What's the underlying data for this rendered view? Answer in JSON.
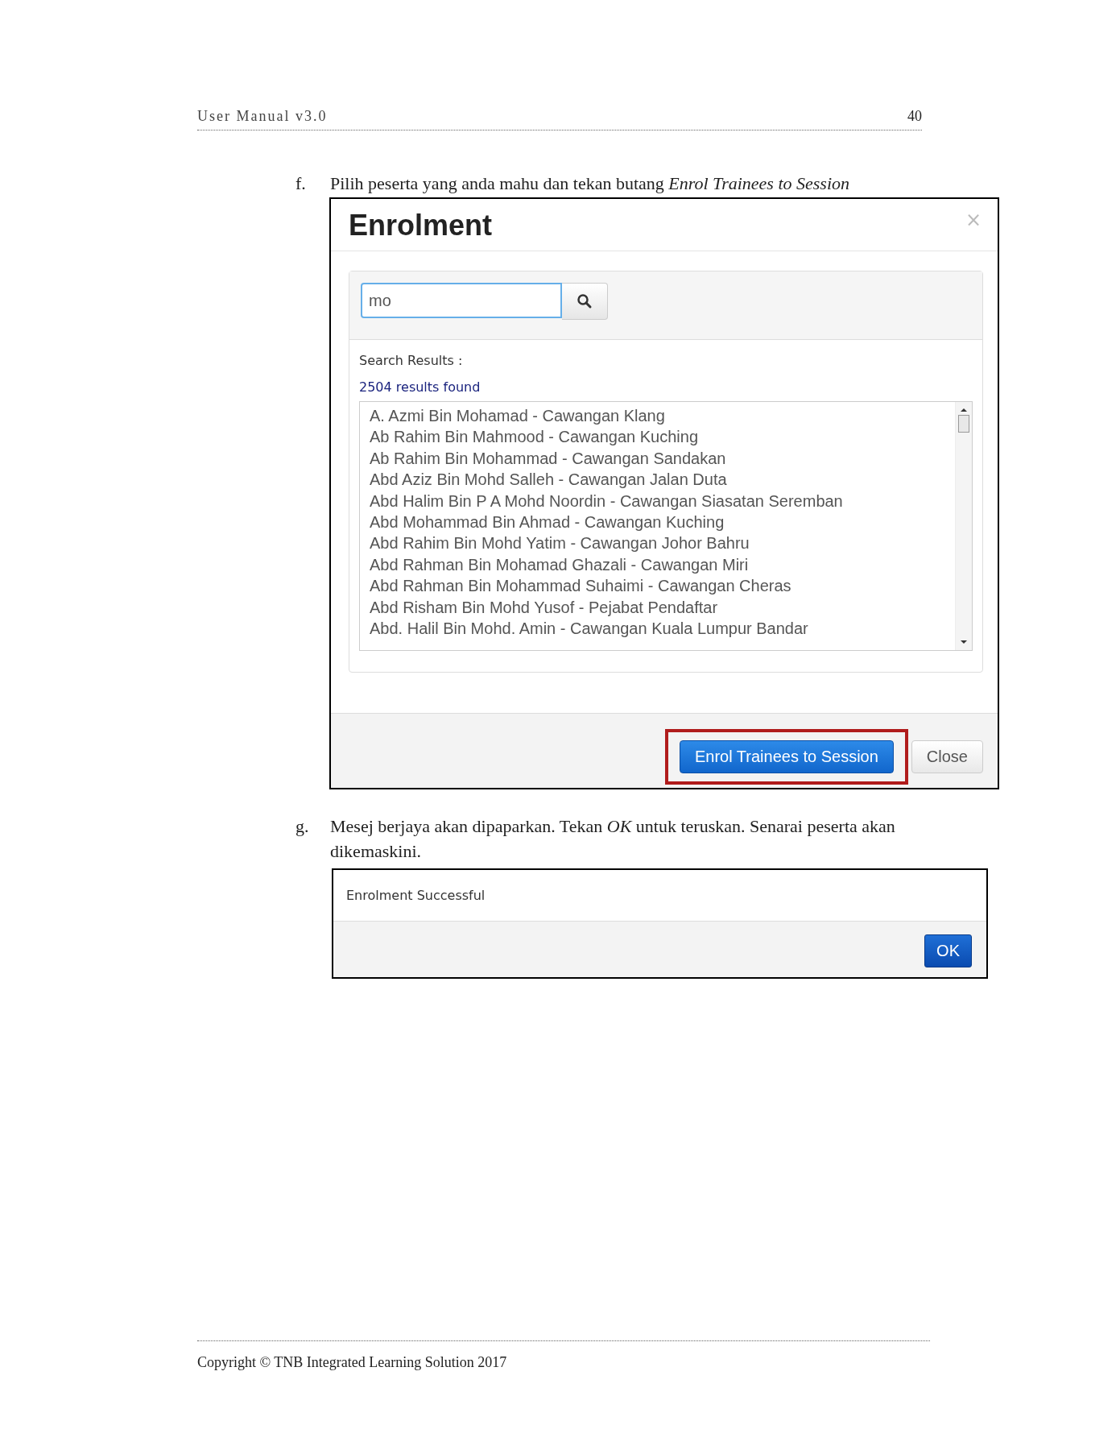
{
  "header": {
    "title": "User Manual v3.0",
    "page": "40"
  },
  "steps": [
    {
      "marker": "f.",
      "text": "Pilih peserta yang anda mahu dan tekan butang *Enrol Trainees to Session*",
      "kind": "enrolment"
    },
    {
      "marker": "g.",
      "text": "Mesej berjaya akan dipaparkan. Tekan *OK* untuk teruskan. Senarai peserta akan dikemaskini.",
      "kind": "message"
    }
  ],
  "enrolment_dialog": {
    "title": "Enrolment",
    "close": "×",
    "search_value": "mo",
    "results_label": "Search Results :",
    "results_count": "2504 results found",
    "results": [
      "A. Azmi Bin Mohamad - Cawangan Klang",
      "Ab Rahim Bin Mahmood - Cawangan Kuching",
      "Ab Rahim Bin Mohammad - Cawangan Sandakan",
      "Abd Aziz Bin Mohd Salleh - Cawangan Jalan Duta",
      "Abd Halim Bin P A Mohd Noordin - Cawangan Siasatan Seremban",
      "Abd Mohammad Bin Ahmad - Cawangan Kuching",
      "Abd Rahim Bin Mohd Yatim - Cawangan Johor Bahru",
      "Abd Rahman Bin Mohamad Ghazali - Cawangan Miri",
      "Abd Rahman Bin Mohammad Suhaimi - Cawangan Cheras",
      "Abd Risham Bin Mohd Yusof - Pejabat Pendaftar",
      "Abd. Halil Bin Mohd. Amin - Cawangan Kuala Lumpur Bandar"
    ],
    "buttons": [
      {
        "label": "Enrol Trainees to Session",
        "kind": "primary",
        "highlighted": true
      },
      {
        "label": "Close",
        "kind": "default",
        "highlighted": false
      }
    ]
  },
  "message_dialog": {
    "message": "Enrolment Successful",
    "button": "OK"
  },
  "footer": "Copyright © TNB Integrated Learning Solution 2017"
}
